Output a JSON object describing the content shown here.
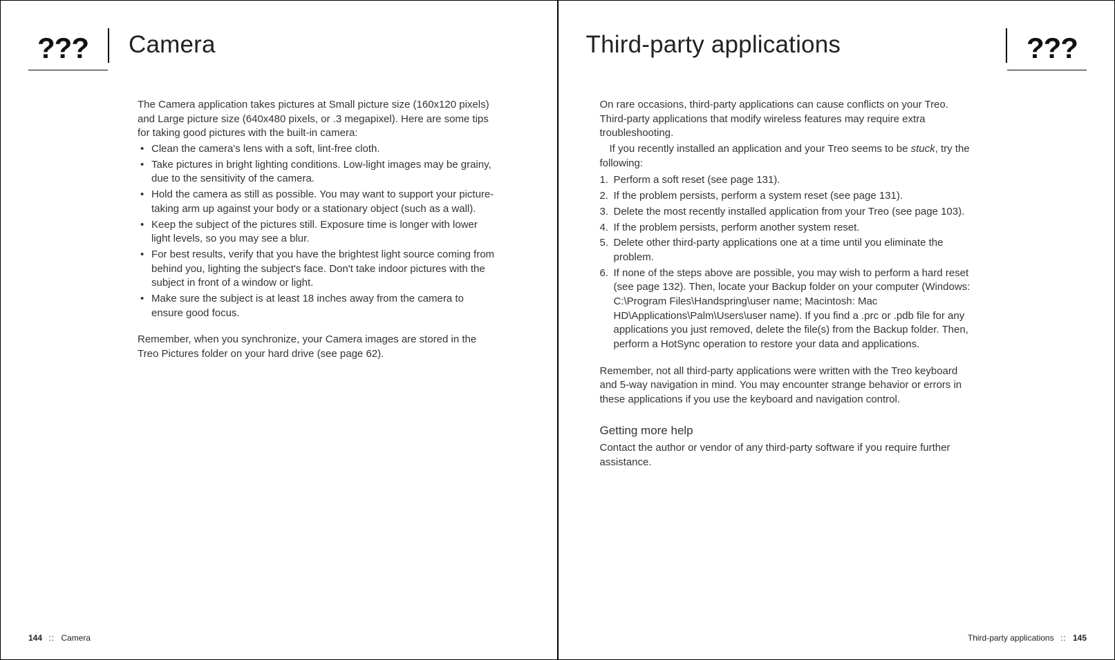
{
  "marker": "???",
  "left": {
    "title": "Camera",
    "intro": "The Camera application takes pictures at Small picture size (160x120 pixels) and Large picture size (640x480 pixels, or .3 megapixel). Here are some tips for taking good pictures with the built-in camera:",
    "bullets": [
      "Clean the camera's lens with a soft, lint-free cloth.",
      "Take pictures in bright lighting conditions. Low-light images may be grainy, due to the sensitivity of the camera.",
      "Hold the camera as still as possible. You may want to support your picture-taking arm up against your body or a stationary object (such as a wall).",
      "Keep the subject of the pictures still. Exposure time is longer with lower light levels, so you may see a blur.",
      "For best results, verify that you have the brightest light source coming from behind you, lighting the subject's face. Don't take indoor pictures with the subject in front of a window or light.",
      "Make sure the subject is at least 18 inches away from the camera to ensure good focus."
    ],
    "outro": "Remember, when you synchronize, your Camera images are stored in the Treo Pictures folder on your hard drive (see page 62).",
    "footer_page": "144",
    "footer_label": "Camera"
  },
  "right": {
    "title": "Third-party applications",
    "intro1": "On rare occasions, third-party applications can cause conflicts on your Treo. Third-party applications that modify wireless features may require extra troubleshooting.",
    "intro2_pre": "If you recently installed an application and your Treo seems to be ",
    "intro2_em": "stuck",
    "intro2_post": ", try the following:",
    "steps": [
      "Perform a soft reset (see page 131).",
      "If the problem persists, perform a system reset (see page 131).",
      "Delete the most recently installed application from your Treo (see page 103).",
      "If the problem persists, perform another system reset.",
      "Delete other third-party applications one at a time until you eliminate the problem.",
      "If none of the steps above are possible, you may wish to perform a hard reset (see page 132). Then, locate your Backup folder on your computer (Windows: C:\\Program Files\\Handspring\\user name; Macintosh: Mac HD\\Applications\\Palm\\Users\\user name). If you find a .prc or .pdb file for any applications you just removed, delete the file(s) from the Backup folder. Then, perform a HotSync operation to restore your data and applications."
    ],
    "outro": "Remember, not all third-party applications were written with the Treo keyboard and 5-way navigation in mind. You may encounter strange behavior or errors in these applications if you use the keyboard and navigation control.",
    "subhead": "Getting more help",
    "subbody": "Contact the author or vendor of any third-party software if you require further assistance.",
    "footer_label": "Third-party applications",
    "footer_page": "145"
  }
}
